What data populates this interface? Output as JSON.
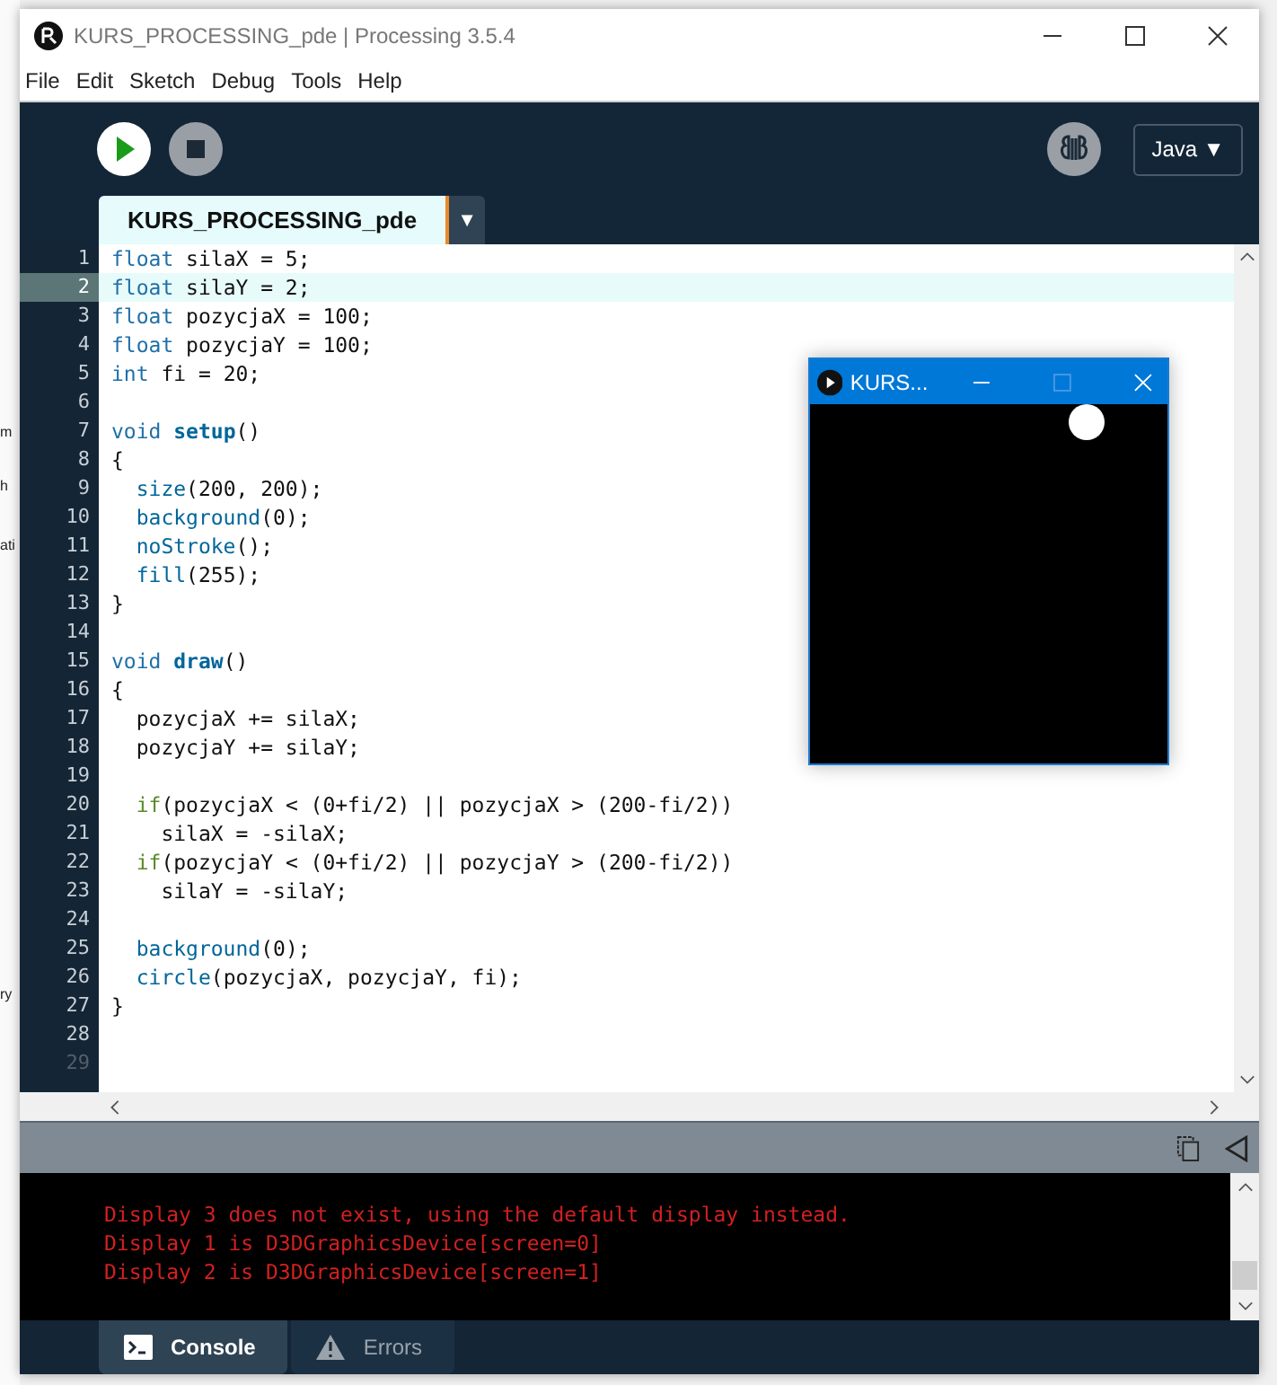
{
  "background_window": {
    "fragments": [
      "m",
      "h",
      "ati",
      "ry"
    ]
  },
  "window": {
    "title": "KURS_PROCESSING_pde | Processing 3.5.4"
  },
  "menu": [
    "File",
    "Edit",
    "Sketch",
    "Debug",
    "Tools",
    "Help"
  ],
  "toolbar": {
    "mode": "Java",
    "mode_caret": "▼"
  },
  "tabs": [
    {
      "label": "KURS_PROCESSING_pde",
      "selected": true
    }
  ],
  "tab_menu": "▼",
  "editor": {
    "lines": [
      {
        "number": "1",
        "selected": false,
        "tokens": [
          {
            "kind": "type",
            "text": "float"
          },
          {
            "kind": "plain",
            "text": " silaX = 5;"
          }
        ]
      },
      {
        "number": "2",
        "selected": true,
        "tokens": [
          {
            "kind": "type",
            "text": "float"
          },
          {
            "kind": "plain",
            "text": " silaY = 2;"
          }
        ]
      },
      {
        "number": "3",
        "selected": false,
        "tokens": [
          {
            "kind": "type",
            "text": "float"
          },
          {
            "kind": "plain",
            "text": " pozycjaX = 100;"
          }
        ]
      },
      {
        "number": "4",
        "selected": false,
        "tokens": [
          {
            "kind": "type",
            "text": "float"
          },
          {
            "kind": "plain",
            "text": " pozycjaY = 100;"
          }
        ]
      },
      {
        "number": "5",
        "selected": false,
        "tokens": [
          {
            "kind": "type",
            "text": "int"
          },
          {
            "kind": "plain",
            "text": " fi = 20;"
          }
        ]
      },
      {
        "number": "6",
        "selected": false
      },
      {
        "number": "7",
        "selected": false,
        "tokens": [
          {
            "kind": "type",
            "text": "void "
          },
          {
            "kind": "definition",
            "text": "setup"
          },
          {
            "kind": "plain",
            "text": "()"
          }
        ]
      },
      {
        "number": "8",
        "selected": false,
        "tokens": [
          {
            "kind": "plain",
            "text": "{"
          }
        ]
      },
      {
        "number": "9",
        "selected": false,
        "tokens": [
          {
            "kind": "function",
            "text": "  size"
          },
          {
            "kind": "plain",
            "text": "(200, 200);"
          }
        ]
      },
      {
        "number": "10",
        "selected": false,
        "tokens": [
          {
            "kind": "function",
            "text": "  background"
          },
          {
            "kind": "plain",
            "text": "(0);"
          }
        ]
      },
      {
        "number": "11",
        "selected": false,
        "tokens": [
          {
            "kind": "function",
            "text": "  noStroke"
          },
          {
            "kind": "plain",
            "text": "();"
          }
        ]
      },
      {
        "number": "12",
        "selected": false,
        "tokens": [
          {
            "kind": "function",
            "text": "  fill"
          },
          {
            "kind": "plain",
            "text": "(255);"
          }
        ]
      },
      {
        "number": "13",
        "selected": false,
        "tokens": [
          {
            "kind": "plain",
            "text": "}"
          }
        ]
      },
      {
        "number": "14",
        "selected": false
      },
      {
        "number": "15",
        "selected": false,
        "tokens": [
          {
            "kind": "type",
            "text": "void "
          },
          {
            "kind": "definition",
            "text": "draw"
          },
          {
            "kind": "plain",
            "text": "()"
          }
        ]
      },
      {
        "number": "16",
        "selected": false,
        "tokens": [
          {
            "kind": "plain",
            "text": "{"
          }
        ]
      },
      {
        "number": "17",
        "selected": false,
        "tokens": [
          {
            "kind": "plain",
            "text": "  pozycjaX += silaX;"
          }
        ]
      },
      {
        "number": "18",
        "selected": false,
        "tokens": [
          {
            "kind": "plain",
            "text": "  pozycjaY += silaY;"
          }
        ]
      },
      {
        "number": "19",
        "selected": false
      },
      {
        "number": "20",
        "selected": false,
        "tokens": [
          {
            "kind": "keyword",
            "text": "  if"
          },
          {
            "kind": "plain",
            "text": "(pozycjaX < (0+fi/2) || pozycjaX > (200-fi/2))"
          }
        ]
      },
      {
        "number": "21",
        "selected": false,
        "tokens": [
          {
            "kind": "plain",
            "text": "    silaX = -silaX;"
          }
        ]
      },
      {
        "number": "22",
        "selected": false,
        "tokens": [
          {
            "kind": "keyword",
            "text": "  if"
          },
          {
            "kind": "plain",
            "text": "(pozycjaY < (0+fi/2) || pozycjaY > (200-fi/2))"
          }
        ]
      },
      {
        "number": "23",
        "selected": false,
        "tokens": [
          {
            "kind": "plain",
            "text": "    silaY = -silaY;"
          }
        ]
      },
      {
        "number": "24",
        "selected": false
      },
      {
        "number": "25",
        "selected": false,
        "tokens": [
          {
            "kind": "function",
            "text": "  background"
          },
          {
            "kind": "plain",
            "text": "(0);"
          }
        ]
      },
      {
        "number": "26",
        "selected": false,
        "tokens": [
          {
            "kind": "function",
            "text": "  circle"
          },
          {
            "kind": "plain",
            "text": "(pozycjaX, pozycjaY, fi);"
          }
        ]
      },
      {
        "number": "27",
        "selected": false,
        "tokens": [
          {
            "kind": "plain",
            "text": "}"
          }
        ]
      },
      {
        "number": "28",
        "selected": false
      },
      {
        "number": "29",
        "selected": false
      }
    ]
  },
  "console": {
    "lines": [
      "Display 3 does not exist, using the default display instead.",
      "Display 1 is D3DGraphicsDevice[screen=0]",
      "Display 2 is D3DGraphicsDevice[screen=1]"
    ]
  },
  "console_tabs": [
    {
      "label": "Console",
      "kind": "console",
      "selected": true
    },
    {
      "label": "Errors",
      "kind": "errors",
      "selected": false
    }
  ],
  "sketch_window": {
    "title": "KURS..."
  }
}
